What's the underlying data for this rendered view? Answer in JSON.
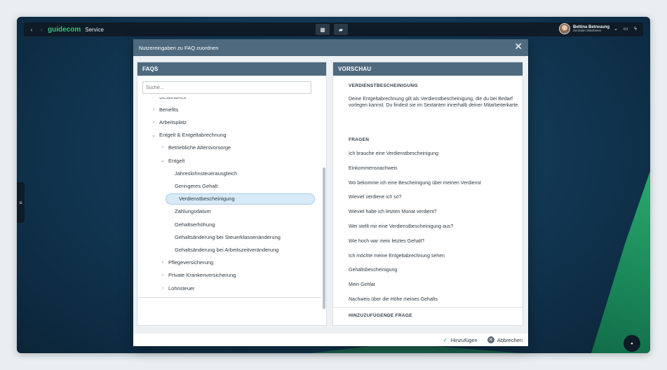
{
  "topbar": {
    "brand": "guidecom",
    "service": "Service",
    "user_name": "Bettina Betreuung",
    "user_role": "Zentraler Mitarbeiter",
    "icons": [
      "back-icon",
      "forward-icon",
      "dashboard-icon",
      "book-icon",
      "chevron-down-icon",
      "window-icon",
      "bolt-icon"
    ]
  },
  "dialog": {
    "title": "Nutzereingaben zu FAQ zuordnen",
    "close_icon": "close-icon",
    "left": {
      "header": "FAQS",
      "search_placeholder": "Suche...",
      "tree": [
        {
          "label": "Gesundheit",
          "level": 1,
          "chevron": "›"
        },
        {
          "label": "Benefits",
          "level": 1,
          "chevron": "›"
        },
        {
          "label": "Arbeitsplatz",
          "level": 1,
          "chevron": "›"
        },
        {
          "label": "Entgelt & Entgeltabrechnung",
          "level": 1,
          "chevron": "⌄"
        },
        {
          "label": "Betriebliche Altersvorsorge",
          "level": 2,
          "chevron": "›"
        },
        {
          "label": "Entgelt",
          "level": 2,
          "chevron": "⌄"
        },
        {
          "label": "Jahreslohnsteuerausgleich",
          "level": 3,
          "chevron": ""
        },
        {
          "label": "Geringeres Gehalt",
          "level": 3,
          "chevron": ""
        },
        {
          "label": "Verdienstbescheinigung",
          "level": 3,
          "chevron": "",
          "selected": true
        },
        {
          "label": "Zahlungsdatum",
          "level": 3,
          "chevron": ""
        },
        {
          "label": "Gehaltserhöhung",
          "level": 3,
          "chevron": ""
        },
        {
          "label": "Gehaltsänderung bei Steuerklassenänderung",
          "level": 3,
          "chevron": ""
        },
        {
          "label": "Gehaltsänderung bei Arbeitszeitveränderung",
          "level": 3,
          "chevron": ""
        },
        {
          "label": "Pflegeversicherung",
          "level": 2,
          "chevron": "›"
        },
        {
          "label": "Private Krankenversicherung",
          "level": 2,
          "chevron": "›"
        },
        {
          "label": "Lohnsteuer",
          "level": 2,
          "chevron": "›"
        }
      ]
    },
    "right": {
      "header": "VORSCHAU",
      "title": "VERDIENSTBESCHEINIGUNG",
      "description": "Deine Entgeltabrechnung gilt als Verdienstbescheinigung, die du bei Bedarf vorlegen kannst. Du findest sie im Sextanten innerhalb deiner Mitarbeiterkarte.",
      "questions_header": "FRAGEN",
      "questions": [
        "Ich brauche eine Verdienstbescheinigung",
        "Einkommensnachweis",
        "Wo bekomme ich eine Bescheinigung über meinen Verdienst",
        "Wieviel verdiene ich so?",
        "Wieviel habe ich letzten Monat verdient?",
        "Wer stellt mir eine Verdienstbescheinigung aus?",
        "Wie hoch war mein letztes Gehalt?",
        "Ich möchte meine Entgeltabrechnung sehen",
        "Gehaltsbescheinigung",
        "Mein Gehlat",
        "Nachweis über die Höhe meines Gehalts"
      ],
      "add_header": "HINZUZUFÜGENDE FRAGE"
    },
    "footer": {
      "add_label": "Hinzufügen",
      "cancel_label": "Abbrechen"
    }
  }
}
